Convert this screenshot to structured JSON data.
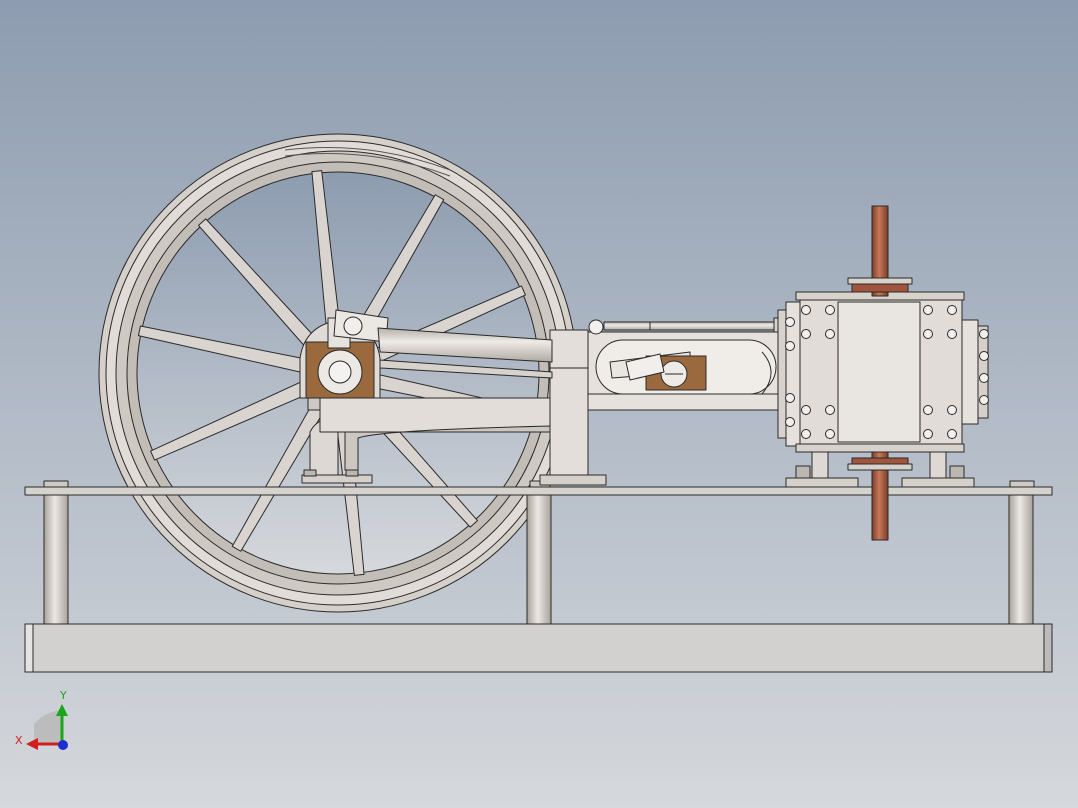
{
  "viewport": {
    "background_top": "#8d9cb0",
    "background_bottom": "#d5d8dc"
  },
  "colors": {
    "metal": "#d8d2cc",
    "metal_light": "#e9e5e1",
    "metal_dark": "#b3aca6",
    "edge": "#2a2a2a",
    "bronze": "#9a6a3e",
    "copper": "#a0563c"
  },
  "triad": {
    "x_label": "X",
    "y_label": "Y",
    "x_color": "#d21e1e",
    "y_color": "#1aa51a",
    "z_color": "#1b2fd0"
  },
  "icons": [
    "view-triad-icon"
  ]
}
